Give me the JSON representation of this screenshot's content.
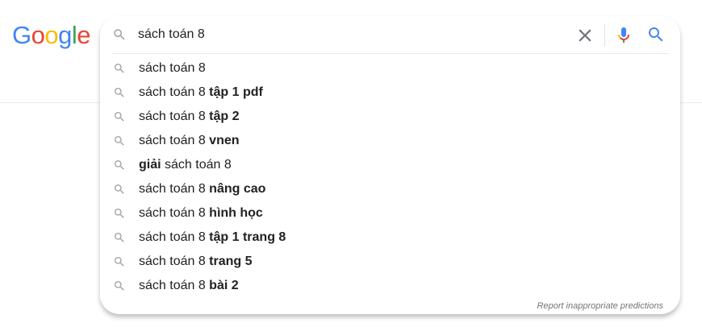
{
  "logo": {
    "letters": [
      {
        "ch": "G",
        "color": "#4285f4"
      },
      {
        "ch": "o",
        "color": "#ea4335"
      },
      {
        "ch": "o",
        "color": "#fbbc05"
      },
      {
        "ch": "g",
        "color": "#4285f4"
      },
      {
        "ch": "l",
        "color": "#34a853"
      },
      {
        "ch": "e",
        "color": "#ea4335"
      }
    ]
  },
  "search": {
    "value": "sách toán 8"
  },
  "icons": {
    "search": "search-icon",
    "clear": "close-icon",
    "mic": "microphone-icon",
    "submit": "search-icon"
  },
  "colors": {
    "blue": "#4285f4",
    "red": "#ea4335",
    "yellow": "#fbbc05",
    "green": "#34a853",
    "icon_gray": "#9aa0a6"
  },
  "suggestions": [
    {
      "pre": "sách toán 8",
      "bold": "",
      "post": ""
    },
    {
      "pre": "sách toán 8 ",
      "bold": "tập 1 pdf",
      "post": ""
    },
    {
      "pre": "sách toán 8 ",
      "bold": "tập 2",
      "post": ""
    },
    {
      "pre": "sách toán 8 ",
      "bold": "vnen",
      "post": ""
    },
    {
      "pre": "",
      "bold": "giải",
      "post": " sách toán 8"
    },
    {
      "pre": "sách toán 8 ",
      "bold": "nâng cao",
      "post": ""
    },
    {
      "pre": "sách toán 8 ",
      "bold": "hình học",
      "post": ""
    },
    {
      "pre": "sách toán 8 ",
      "bold": "tập 1 trang 8",
      "post": ""
    },
    {
      "pre": "sách toán 8 ",
      "bold": "trang 5",
      "post": ""
    },
    {
      "pre": "sách toán 8 ",
      "bold": "bài 2",
      "post": ""
    }
  ],
  "report": {
    "label": "Report inappropriate predictions"
  }
}
